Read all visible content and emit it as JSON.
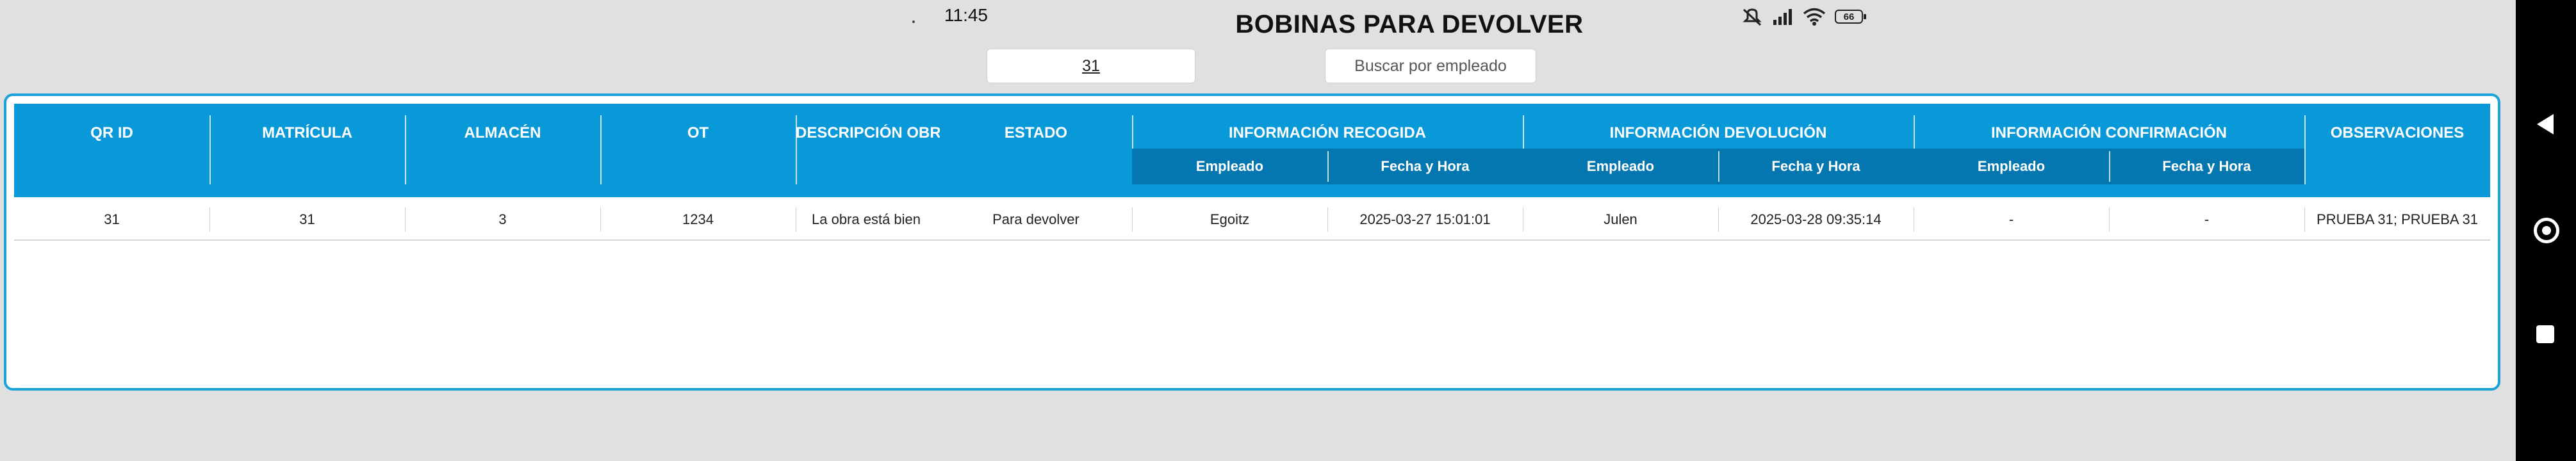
{
  "status_bar": {
    "time": "11:45",
    "battery": "66"
  },
  "page": {
    "title": "BOBINAS PARA DEVOLVER"
  },
  "filters": {
    "qr_value": "31",
    "search_placeholder": "Buscar por empleado"
  },
  "table": {
    "columns": {
      "qr_id": "QR ID",
      "matricula": "MATRÍCULA",
      "almacen": "ALMACÉN",
      "ot": "OT",
      "descripcion": "DESCRIPCIÓN OBRA",
      "estado": "ESTADO",
      "recogida": "INFORMACIÓN RECOGIDA",
      "devolucion": "INFORMACIÓN DEVOLUCIÓN",
      "confirmacion": "INFORMACIÓN CONFIRMACIÓN",
      "observaciones": "OBSERVACIONES"
    },
    "subcolumns": {
      "empleado": "Empleado",
      "fecha_hora": "Fecha y Hora"
    },
    "rows": [
      {
        "qr_id": "31",
        "matricula": "31",
        "almacen": "3",
        "ot": "1234",
        "descripcion": "La obra está bien",
        "estado": "Para devolver",
        "recogida_empleado": "Egoitz",
        "recogida_fecha": "2025-03-27 15:01:01",
        "devolucion_empleado": "Julen",
        "devolucion_fecha": "2025-03-28 09:35:14",
        "confirmacion_empleado": "-",
        "confirmacion_fecha": "-",
        "observaciones": "PRUEBA 31; PRUEBA 31"
      }
    ]
  }
}
